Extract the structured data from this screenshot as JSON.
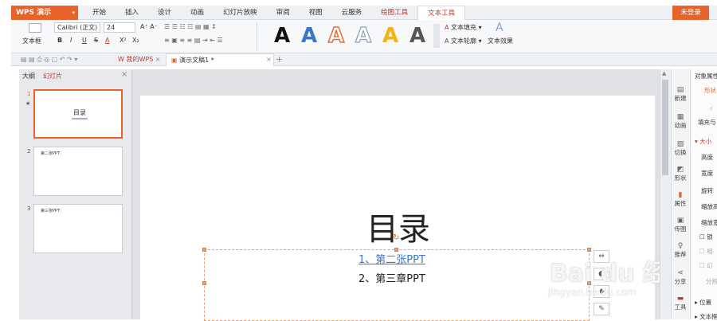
{
  "app": {
    "name": "WPS 演示",
    "login_label": "未登录"
  },
  "menu_tabs": [
    "开始",
    "插入",
    "设计",
    "动画",
    "幻灯片放映",
    "审阅",
    "视图",
    "云服务",
    "绘图工具",
    "文本工具"
  ],
  "ribbon": {
    "textbox_label": "文本框",
    "font_name": "Calibri (正文)",
    "font_size": "24",
    "fmt_buttons": [
      "B",
      "I",
      "U",
      "S",
      "A",
      "X²",
      "X₂"
    ],
    "text_fill": "文本填充",
    "text_outline": "文本轮廓",
    "text_effect": "文本效果",
    "style_letters": [
      "A",
      "A",
      "A",
      "A",
      "A",
      "A"
    ],
    "style_colors": [
      "#111111",
      "#3b78c4",
      "#e0703a",
      "#8aa0b8",
      "#f2b316",
      "#555555"
    ]
  },
  "doc_tabs": {
    "home": "我的WPS",
    "current": "演示文稿1 *"
  },
  "left_panel": {
    "tab_outline": "大纲",
    "tab_slides": "幻灯片"
  },
  "slides": [
    {
      "num": "1",
      "title": "目录",
      "selected": true
    },
    {
      "num": "2",
      "title": "第二张PPT",
      "selected": false
    },
    {
      "num": "3",
      "title": "第三张PPT",
      "selected": false
    }
  ],
  "slide_content": {
    "title": "目录",
    "line1": "1、第二张PPT",
    "line2": "2、第三章PPT"
  },
  "right_bar": [
    "新建",
    "动画",
    "切换",
    "形状",
    "属性",
    "传图",
    "推荐",
    "分享",
    "工具"
  ],
  "property_panel": {
    "title": "对象属性",
    "tab": "形状",
    "fill_label": "填充与",
    "size_label": "大小",
    "items": [
      "高度",
      "宽度",
      "旋转",
      "缩放高",
      "缩放宽",
      "锁",
      "相",
      "幻",
      "分辨"
    ],
    "pos_label": "位置",
    "textbox_label": "文本框"
  },
  "watermark": {
    "main": "Bai du 经验",
    "sub": "jingyan.baidu.com"
  },
  "accent_color": "#e8632a"
}
